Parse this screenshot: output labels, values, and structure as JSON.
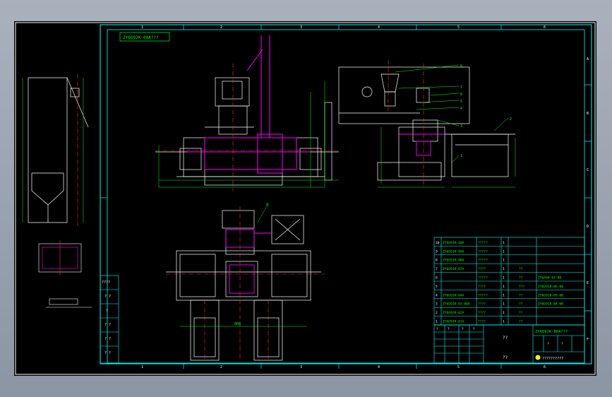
{
  "drawing": {
    "title_stamp": "ZY6O9JK-00A???",
    "grid_top_labels": [
      "1",
      "2",
      "3",
      "4",
      "5",
      "6"
    ],
    "grid_side_labels": [
      "A",
      "B",
      "C",
      "D",
      "E",
      "F"
    ],
    "left_block_labels": [
      "????",
      "? ?",
      "?",
      "? ?",
      "? ?",
      "? ?"
    ],
    "callouts": [
      "8",
      "7",
      "6",
      "5",
      "4",
      "3",
      "2",
      "1"
    ],
    "balloon_bottom": "9",
    "dim_center": "800"
  },
  "bom": {
    "rows": [
      {
        "no": "10",
        "code": "ZY6O9JK-10A",
        "name": "?????",
        "qty": "1"
      },
      {
        "no": "9",
        "code": "ZY6O9JK-09A",
        "name": "?????",
        "qty": "1"
      },
      {
        "no": "8",
        "code": "ZY6O9JK-08A",
        "name": "?????",
        "qty": "1"
      },
      {
        "no": "7",
        "code": "ZY6O9JK-07A",
        "name": "????",
        "qty": "1",
        "note": "??"
      },
      {
        "no": "6",
        "code": "",
        "name": "?????",
        "qty": "1",
        "note": "??",
        "std": "ZY6A04-01-00"
      },
      {
        "no": "5",
        "code": "",
        "name": "????",
        "qty": "1",
        "note": "???",
        "std": "ZY6O918-06-00"
      },
      {
        "no": "4",
        "code": "ZY6O9JK-04A",
        "name": "?????",
        "qty": "1",
        "note": "??",
        "std": "ZY6O918-05-00"
      },
      {
        "no": "3",
        "code": "ZY6O9JK-03-00A",
        "name": "????",
        "qty": "1",
        "note": "??",
        "std": "ZY6O918-04-00"
      },
      {
        "no": "2",
        "code": "ZY6O9JK-02A",
        "name": "????",
        "qty": "1",
        "note": "??"
      },
      {
        "no": "1",
        "code": "ZY6O9JK-01A",
        "name": "????",
        "qty": "1",
        "note": "??"
      }
    ],
    "header": [
      "?",
      "?",
      "?",
      "?",
      "?",
      "?"
    ]
  },
  "title_block": {
    "drawing_no": "ZY6O9JK-00A???",
    "name": "??",
    "company": "??",
    "footer": "??????????"
  },
  "colors": {
    "frame": "#00ffff",
    "part": "#ffffff",
    "accent": "#ff00ff",
    "center": "#ff3030",
    "dim": "#00ff00",
    "mark": "#ffff00"
  }
}
